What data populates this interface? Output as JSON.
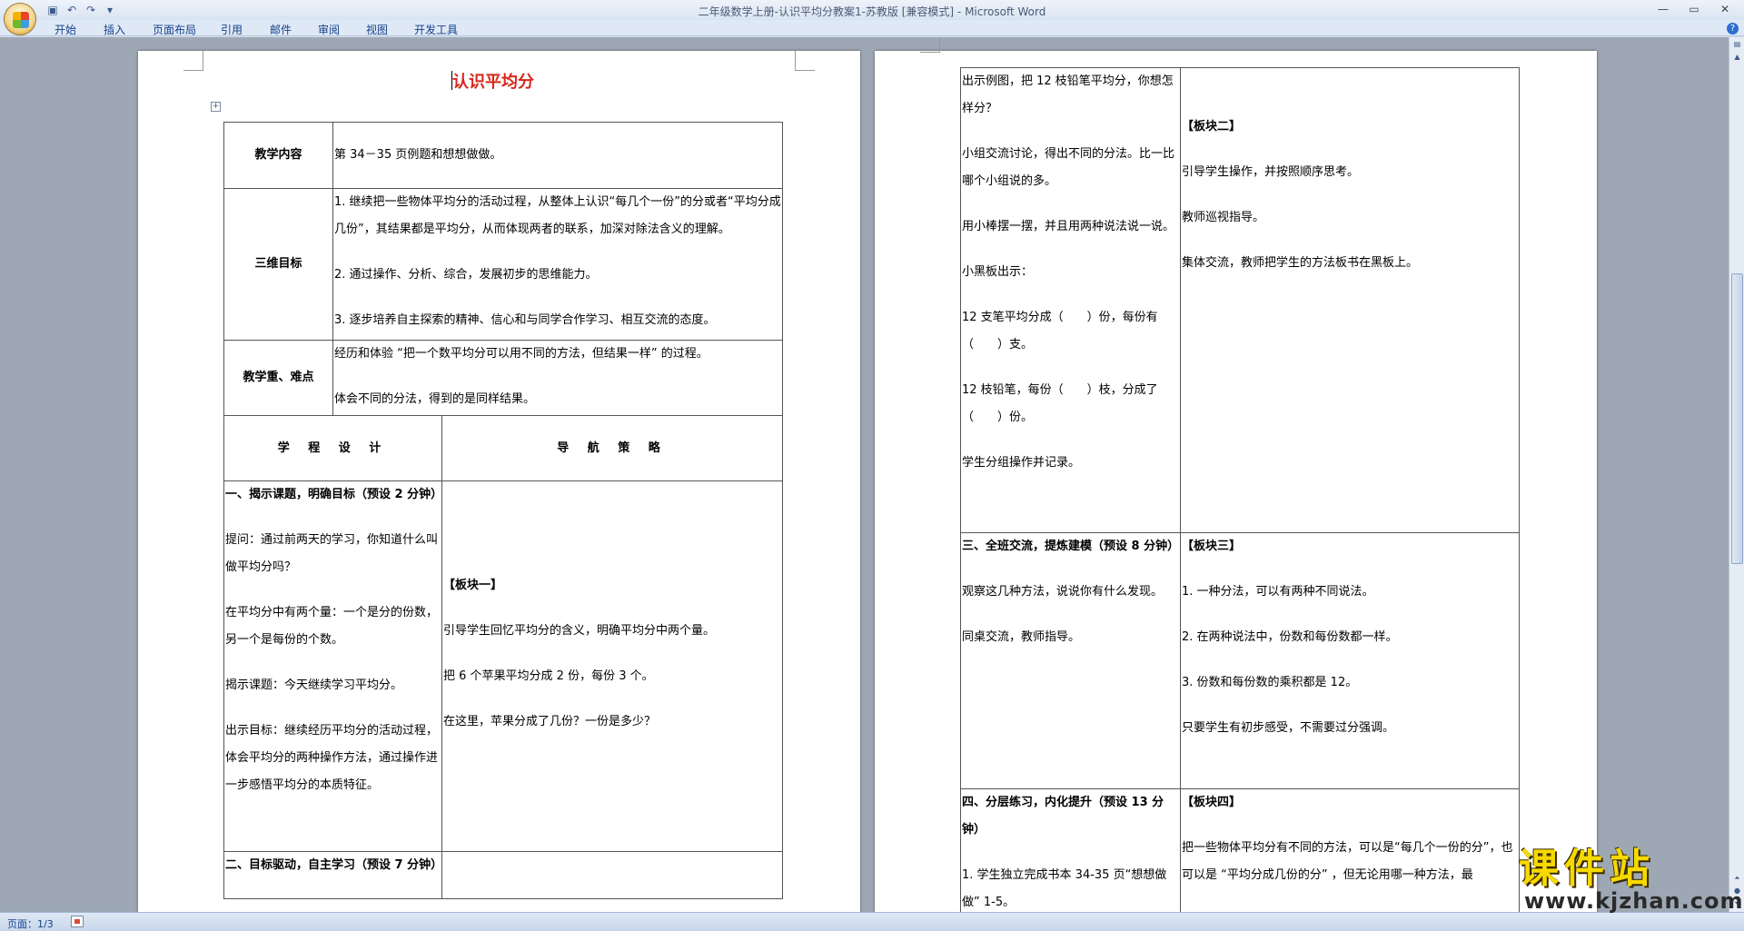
{
  "window": {
    "title": "二年级数学上册-认识平均分教案1-苏教版 [兼容模式] -",
    "app_name": "Microsoft Word"
  },
  "ribbon": {
    "tabs": [
      "开始",
      "插入",
      "页面布局",
      "引用",
      "邮件",
      "审阅",
      "视图",
      "开发工具"
    ]
  },
  "document": {
    "title": "认识平均分",
    "page1": {
      "content_label": "教学内容",
      "content_value": "第 34－35 页例题和想想做做。",
      "goals_label": "三维目标",
      "goals": [
        "1. 继续把一些物体平均分的活动过程，从整体上认识“每几个一份”的分或者“平均分成几份”，其结果都是平均分，从而体现两者的联系，加深对除法含义的理解。",
        "2. 通过操作、分析、综合，发展初步的思维能力。",
        "3. 逐步培养自主探索的精神、信心和与同学合作学习、相互交流的态度。"
      ],
      "focus_label": "教学重、难点",
      "focus": [
        "经历和体验 “把一个数平均分可以用不同的方法，但结果一样” 的过程。",
        "体会不同的分法，得到的是同样结果。"
      ],
      "col1_header": "学 程 设 计",
      "col2_header": "导 航 策 略",
      "section1_title": "一、揭示课题，明确目标（预设 2 分钟）",
      "section1_left": [
        "提问：通过前两天的学习，你知道什么叫做平均分吗？",
        "在平均分中有两个量：一个是分的份数，另一个是每份的个数。",
        "揭示课题：今天继续学习平均分。",
        "出示目标：继续经历平均分的活动过程，体会平均分的两种操作方法，通过操作进一步感悟平均分的本质特征。"
      ],
      "section1_right": [
        "【板块一】",
        "引导学生回忆平均分的含义，明确平均分中两个量。",
        "把 6 个苹果平均分成 2 份，每份 3 个。",
        "在这里，苹果分成了几份？一份是多少？"
      ],
      "section2_title": "二、目标驱动，自主学习（预设 7 分钟）"
    },
    "page2": {
      "row1_left": [
        "出示例图，把 12 枝铅笔平均分，你想怎样分？",
        "小组交流讨论，得出不同的分法。比一比哪个小组说的多。",
        "用小棒摆一摆，并且用两种说法说一说。",
        "小黑板出示：",
        "12 支笔平均分成（　　）份，每份有（　　）支。",
        "12 枝铅笔，每份（　　）枝，分成了（　　）份。",
        "学生分组操作并记录。"
      ],
      "row1_right": [
        "【板块二】",
        "引导学生操作，并按照顺序思考。",
        "教师巡视指导。",
        "集体交流，教师把学生的方法板书在黑板上。"
      ],
      "section3_title": "三、全班交流，提炼建模（预设 8 分钟）",
      "section3_left": [
        "观察这几种方法，说说你有什么发现。",
        "同桌交流，教师指导。"
      ],
      "section3_right_title": "【板块三】",
      "section3_right": [
        "1. 一种分法，可以有两种不同说法。",
        "2. 在两种说法中，份数和每份数都一样。",
        "3. 份数和每份数的乘积都是 12。",
        "只要学生有初步感受，不需要过分强调。"
      ],
      "section4_title": "四、分层练习，内化提升（预设 13 分钟）",
      "section4_left": [
        "1. 学生独立完成书本 34-35 页“想想做做” 1-5。"
      ],
      "section4_right_title": "【板块四】",
      "section4_right": [
        "把一些物体平均分有不同的方法，可以是“每几个一份的分”，也可以是 “平均分成几份的分” ，但无论用哪一种方法，最"
      ]
    }
  },
  "status": {
    "page": "页面：1/3"
  },
  "watermark": {
    "main": "课件站",
    "url": "www.kjzhan.com"
  },
  "colors": {
    "title_red": "#d8261b",
    "ribbon_blue": "#15428b",
    "watermark_yellow": "#f6d900"
  }
}
